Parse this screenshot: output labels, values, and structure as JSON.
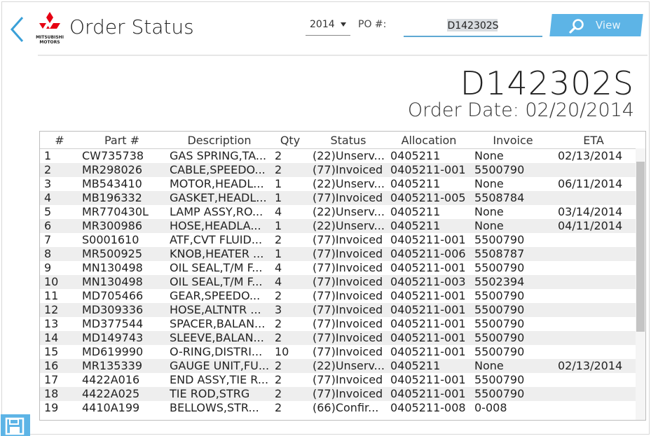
{
  "header": {
    "title": "Order Status",
    "logo_text": "MITSUBISHI\nMOTORS",
    "year": "2014",
    "po_label": "PO #:",
    "po_value": "D142302S",
    "view_label": "View"
  },
  "order": {
    "po_number": "D142302S",
    "order_date": "Order Date: 02/20/2014"
  },
  "table": {
    "columns": [
      "#",
      "Part #",
      "Description",
      "Qty",
      "Status",
      "Allocation",
      "Invoice",
      "ETA"
    ],
    "rows": [
      [
        "1",
        "CW735738",
        "GAS SPRING,TA...",
        "2",
        "(22)Unserv...",
        "0405211",
        "None",
        "02/13/2014"
      ],
      [
        "2",
        "MR298026",
        "CABLE,SPEEDO...",
        "2",
        "(77)Invoiced",
        "0405211-001",
        "5500790",
        ""
      ],
      [
        "3",
        "MB543410",
        "MOTOR,HEADL...",
        "1",
        "(22)Unserv...",
        "0405211",
        "None",
        "06/11/2014"
      ],
      [
        "4",
        "MB196332",
        "GASKET,HEADL...",
        "1",
        "(77)Invoiced",
        "0405211-005",
        "5508784",
        ""
      ],
      [
        "5",
        "MR770430L",
        "LAMP ASSY,RO...",
        "4",
        "(22)Unserv...",
        "0405211",
        "None",
        "03/14/2014"
      ],
      [
        "6",
        "MR300986",
        "HOSE,HEADLA...",
        "1",
        "(22)Unserv...",
        "0405211",
        "None",
        "04/11/2014"
      ],
      [
        "7",
        "S0001610",
        "ATF,CVT FLUID...",
        "2",
        "(77)Invoiced",
        "0405211-001",
        "5500790",
        ""
      ],
      [
        "8",
        "MR500925",
        "KNOB,HEATER ...",
        "1",
        "(77)Invoiced",
        "0405211-006",
        "5508787",
        ""
      ],
      [
        "9",
        "MN130498",
        "OIL SEAL,T/M F...",
        "4",
        "(77)Invoiced",
        "0405211-001",
        "5500790",
        ""
      ],
      [
        "10",
        "MN130498",
        "OIL SEAL,T/M F...",
        "4",
        "(77)Invoiced",
        "0405211-003",
        "5502394",
        ""
      ],
      [
        "11",
        "MD705466",
        "GEAR,SPEEDO...",
        "2",
        "(77)Invoiced",
        "0405211-001",
        "5500790",
        ""
      ],
      [
        "12",
        "MD309336",
        "HOSE,ALTNTR ...",
        "3",
        "(77)Invoiced",
        "0405211-001",
        "5500790",
        ""
      ],
      [
        "13",
        "MD377544",
        "SPACER,BALAN...",
        "2",
        "(77)Invoiced",
        "0405211-001",
        "5500790",
        ""
      ],
      [
        "14",
        "MD149743",
        "SLEEVE,BALAN...",
        "2",
        "(77)Invoiced",
        "0405211-001",
        "5500790",
        ""
      ],
      [
        "15",
        "MD619990",
        "O-RING,DISTRI...",
        "10",
        "(77)Invoiced",
        "0405211-001",
        "5500790",
        ""
      ],
      [
        "16",
        "MR135339",
        "GAUGE UNIT,FU...",
        "2",
        "(22)Unserv...",
        "0405211",
        "None",
        "02/13/2014"
      ],
      [
        "17",
        "4422A016",
        "END ASSY,TIE R...",
        "2",
        "(77)Invoiced",
        "0405211-001",
        "5500790",
        ""
      ],
      [
        "18",
        "4422A025",
        "TIE ROD,STRG",
        "2",
        "(77)Invoiced",
        "0405211-001",
        "5500790",
        ""
      ],
      [
        "19",
        "4410A199",
        "BELLOWS,STR...",
        "2",
        "(66)Confir...",
        "0405211-008",
        "0-008",
        ""
      ]
    ]
  },
  "icons": {
    "back": "chevron-left-icon",
    "logo": "mitsubishi-logo",
    "search": "search-icon",
    "save": "save-icon"
  },
  "colors": {
    "accent": "#5db4e6",
    "back_chevron": "#3aa0d8",
    "logo_red": "#e60012",
    "row_alt": "#eeeeee"
  }
}
